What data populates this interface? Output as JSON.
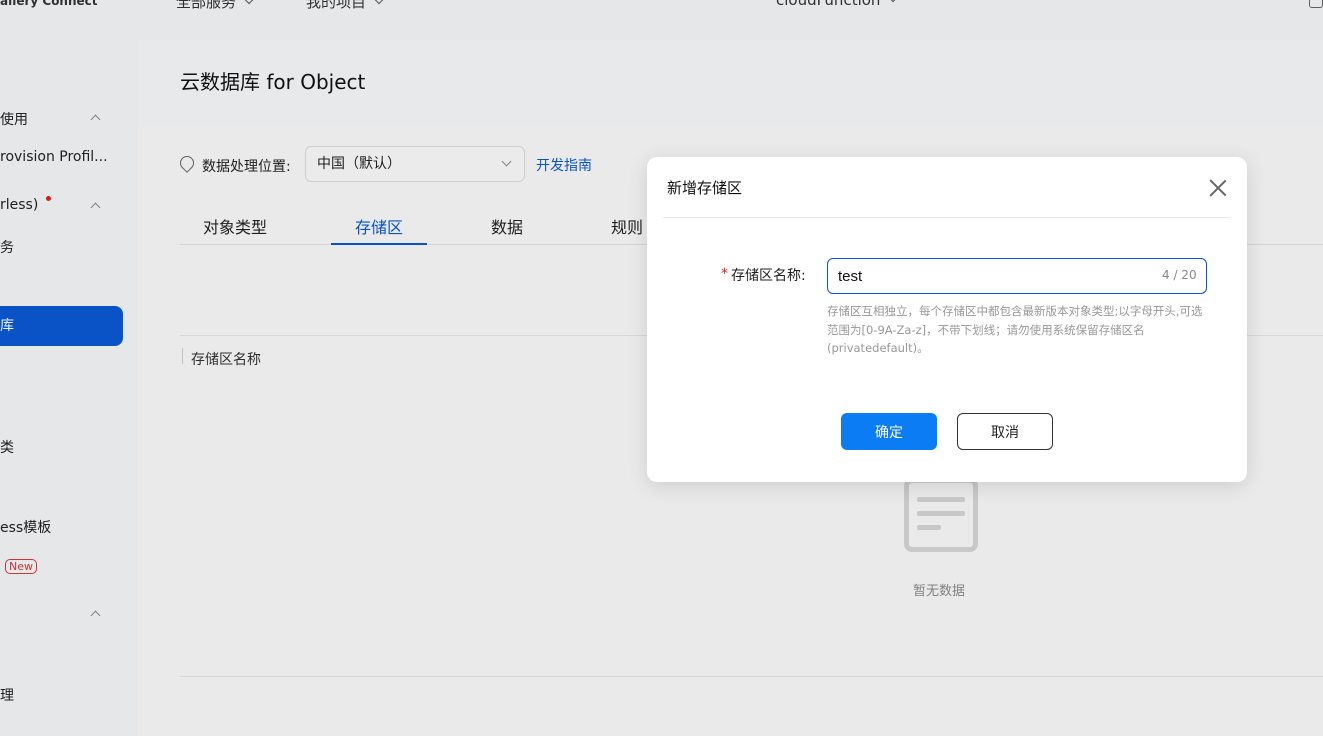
{
  "header": {
    "left_menu": "全部服务",
    "project_menu": "我的项目",
    "app_selector": "cloudFunction",
    "brand": "allery Connect"
  },
  "sidebar": {
    "items": [
      {
        "label": "使用"
      },
      {
        "label": "rovision Profil..."
      },
      {
        "label": "rless)"
      },
      {
        "label": "务"
      },
      {
        "label": "库"
      },
      {
        "label": "类"
      },
      {
        "label": "ess模板"
      },
      {
        "label": "New"
      },
      {
        "label": "理"
      }
    ]
  },
  "main": {
    "page_title": "云数据库 for Object",
    "location": {
      "label": "数据处理位置:",
      "selected": "中国（默认）",
      "guide_link": "开发指南"
    },
    "tabs": [
      {
        "label": "对象类型"
      },
      {
        "label": "存储区"
      },
      {
        "label": "数据"
      },
      {
        "label": "规则"
      }
    ],
    "table": {
      "columns": [
        "存储区名称"
      ],
      "empty_text": "暂无数据"
    }
  },
  "dialog": {
    "title": "新增存储区",
    "required_mark": "*",
    "field_label": "存储区名称:",
    "input_value": "test",
    "char_count": "4 / 20",
    "hint": "存储区互相独立，每个存储区中都包含最新版本对象类型;以字母开头,可选范围为[0-9A-Za-z]，不带下划线；请勿使用系统保留存储区名(privatedefault)。",
    "confirm_label": "确定",
    "cancel_label": "取消"
  },
  "colors": {
    "primary": "#0a59d4",
    "confirm_button": "#0a7df5",
    "required": "#e02020"
  }
}
